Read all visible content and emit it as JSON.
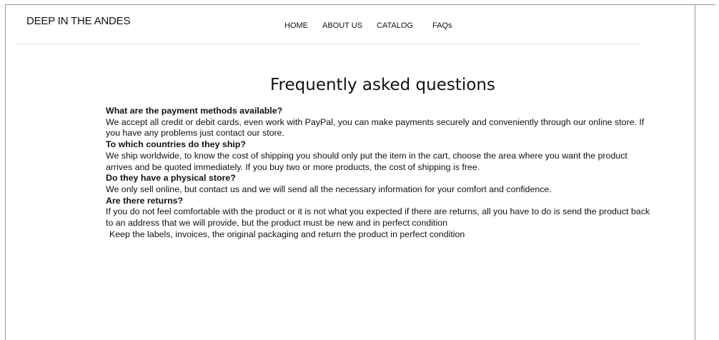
{
  "header": {
    "brand": "DEEP IN THE ANDES",
    "nav": [
      {
        "label": "HOME"
      },
      {
        "label": "ABOUT US"
      },
      {
        "label": "CATALOG"
      },
      {
        "label": "FAQs"
      }
    ]
  },
  "main": {
    "title": "Frequently asked questions",
    "faqs": [
      {
        "question": "What are the payment methods available?",
        "answer": "We accept all credit or debit cards, even work with PayPal, you can make payments securely and conveniently through our online store. If you have any problems just contact our store."
      },
      {
        "question": "To which countries do they ship?",
        "answer": "We ship worldwide, to know the cost of shipping you should only put the item in the cart, choose the area where you want the product arrives and be quoted immediately. If you buy two or more products, the cost of shipping is free."
      },
      {
        "question": "Do they have a physical store?",
        "answer": "We only sell online, but contact us and we will send all the necessary information for your comfort and confidence."
      },
      {
        "question": "Are there returns?",
        "answer": "If you do not feel comfortable with the product or it is not what you expected if there are returns, all you have to do is send the product back to an address that we will provide, but the product must be new and in perfect condition",
        "note": "Keep the labels, invoices, the original packaging and return the product in perfect condition"
      }
    ]
  }
}
